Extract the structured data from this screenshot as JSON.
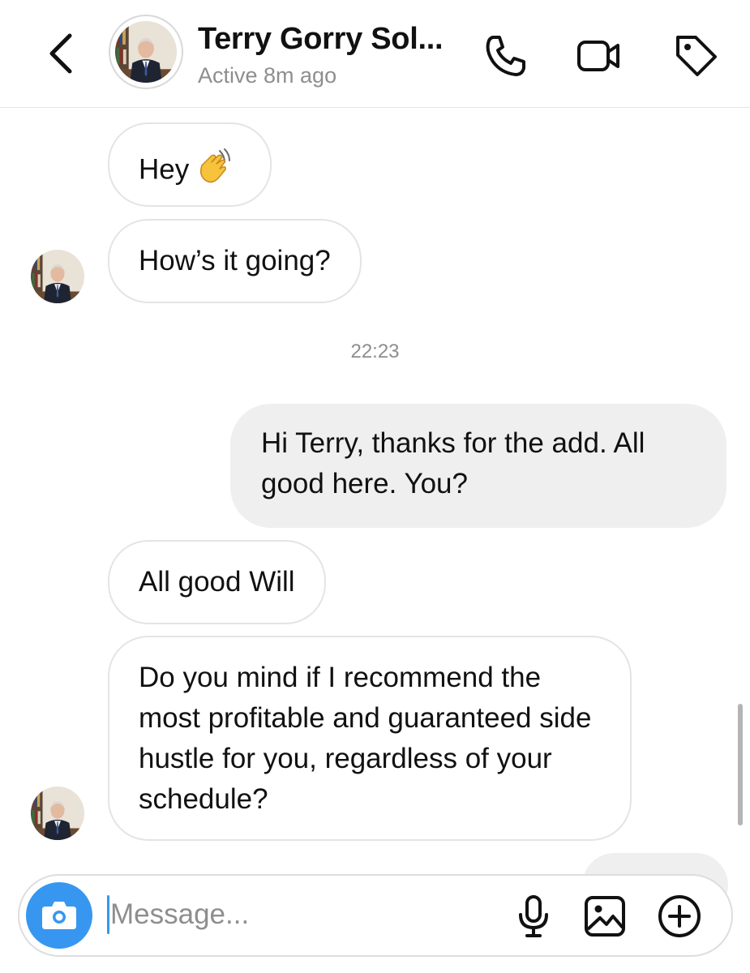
{
  "header": {
    "contact_name": "Terry Gorry Sol...",
    "status": "Active 8m ago",
    "icons": [
      "back-chevron-icon",
      "phone-icon",
      "video-camera-icon",
      "tag-icon"
    ]
  },
  "messages": [
    {
      "from": "contact",
      "text": "Hey",
      "emoji": "waving-hand"
    },
    {
      "from": "contact",
      "text": "How’s it going?"
    },
    {
      "from": "self",
      "text": "Hi Terry, thanks for the add. All good here. You?"
    },
    {
      "from": "contact",
      "text": "All good Will"
    },
    {
      "from": "contact",
      "text": "Do you mind if I recommend the most profitable and guaranteed side hustle for you, regardless of your schedule?"
    }
  ],
  "timestamp": "22:23",
  "composer": {
    "placeholder": "Message...",
    "value": "",
    "icons": [
      "camera-icon",
      "microphone-icon",
      "image-icon",
      "add-circle-icon"
    ]
  },
  "colors": {
    "accent": "#3797f0",
    "incoming_bubble_border": "#e4e4e4",
    "outgoing_bubble": "#efefef",
    "secondary_text": "#8e8e8e"
  }
}
